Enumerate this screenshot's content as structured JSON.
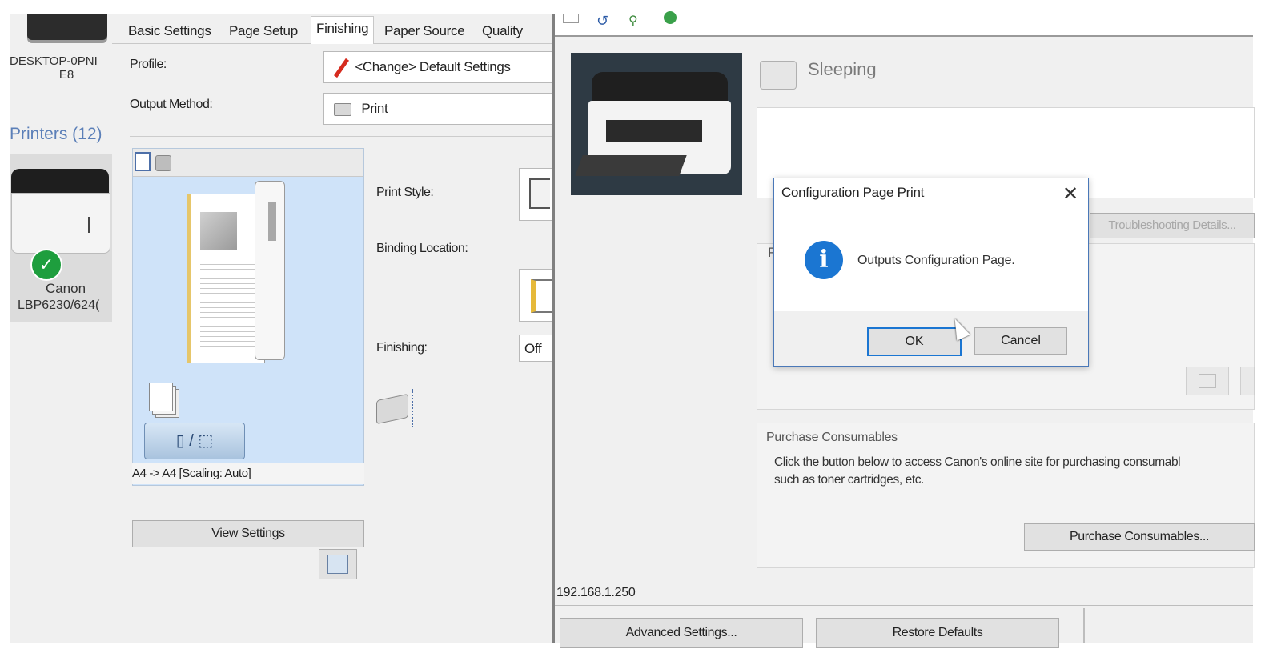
{
  "left_panel": {
    "device_name_line1": "DESKTOP-0PNI",
    "device_name_line2": "E8",
    "printers_heading": "Printers (12)",
    "printer_name_line1": "Canon",
    "printer_name_line2": "LBP6230/624("
  },
  "prefs": {
    "tabs": [
      {
        "label": "Basic Settings"
      },
      {
        "label": "Page Setup"
      },
      {
        "label": "Finishing"
      },
      {
        "label": "Paper Source"
      },
      {
        "label": "Quality"
      }
    ],
    "active_tab": "Finishing",
    "profile_label": "Profile:",
    "profile_value": "<Change> Default Settings",
    "output_method_label": "Output Method:",
    "output_method_value": "Print",
    "scaling_text": "A4 -> A4 [Scaling: Auto]",
    "view_settings_label": "View Settings",
    "print_style_label": "Print Style:",
    "binding_location_label": "Binding Location:",
    "finishing_label": "Finishing:",
    "finishing_value": "Off"
  },
  "monitor": {
    "status": "Sleeping",
    "troubleshooting_label": "Troubleshooting Details...",
    "purchase_heading": "Purchase Consumables",
    "purchase_desc_line1": "Click the button below to access Canon's online site for purchasing consumabl",
    "purchase_desc_line2": "such as toner cartridges, etc.",
    "purchase_button": "Purchase Consumables...",
    "ip_address": "192.168.1.250",
    "partial_label": "P"
  },
  "bottom_buttons": {
    "advanced_settings": "Advanced Settings...",
    "restore_defaults": "Restore Defaults"
  },
  "dialog": {
    "title": "Configuration Page Print",
    "message": "Outputs Configuration Page.",
    "ok_label": "OK",
    "cancel_label": "Cancel",
    "icon": "info-icon"
  },
  "colors": {
    "accent_blue": "#1b76d2",
    "checkmark_green": "#1e9e3e",
    "preview_blue": "#cfe3f9"
  }
}
